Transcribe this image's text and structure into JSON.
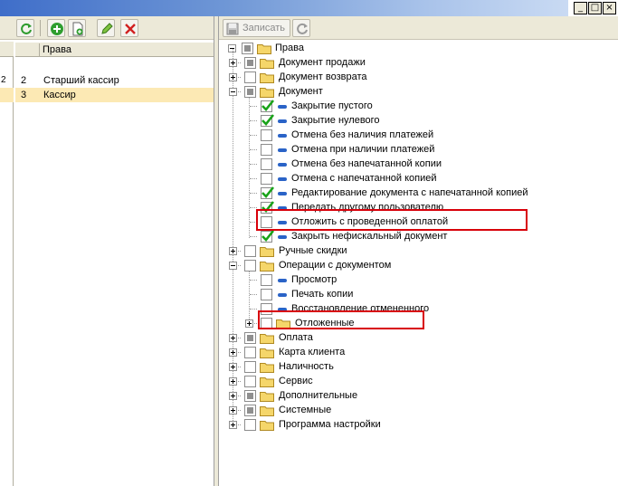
{
  "window": {
    "minimize_glyph": "_",
    "maximize_glyph": "□",
    "close_glyph": "×"
  },
  "left_toolbar": {
    "buttons": [
      "refresh-icon",
      "add-icon",
      "copy-icon",
      "edit-icon",
      "delete-icon"
    ]
  },
  "roles_list": {
    "column_header": "Права",
    "gutter_numbers": [
      "2"
    ],
    "rows": [
      {
        "num": "2",
        "name": "Старший кассир",
        "selected": false
      },
      {
        "num": "3",
        "name": "Кассир",
        "selected": true
      }
    ]
  },
  "right_toolbar": {
    "save_label": "Записать"
  },
  "rights_tree": {
    "root": "Права",
    "items": [
      {
        "label": "Документ продажи",
        "type": "folder",
        "check": "partial",
        "expander": "plus"
      },
      {
        "label": "Документ возврата",
        "type": "folder",
        "check": "none",
        "expander": "plus"
      },
      {
        "label": "Документ",
        "type": "folder",
        "check": "partial",
        "expander": "minus"
      },
      {
        "label": "Закрытие пустого",
        "type": "item",
        "check": "checked"
      },
      {
        "label": "Закрытие нулевого",
        "type": "item",
        "check": "checked"
      },
      {
        "label": "Отмена без наличия платежей",
        "type": "item",
        "check": "none"
      },
      {
        "label": "Отмена при наличии платежей",
        "type": "item",
        "check": "none"
      },
      {
        "label": "Отмена без напечатанной копии",
        "type": "item",
        "check": "none"
      },
      {
        "label": "Отмена с напечатанной копией",
        "type": "item",
        "check": "none"
      },
      {
        "label": "Редактирование документа с напечатанной копией",
        "type": "item",
        "check": "checked"
      },
      {
        "label": "Передать другому пользователю",
        "type": "item",
        "check": "checked"
      },
      {
        "label": "Отложить с проведенной оплатой",
        "type": "item",
        "check": "none"
      },
      {
        "label": "Закрыть нефискальный документ",
        "type": "item",
        "check": "checked"
      },
      {
        "label": "Ручные скидки",
        "type": "folder",
        "check": "none",
        "expander": "plus"
      },
      {
        "label": "Операции с документом",
        "type": "folder",
        "check": "none",
        "expander": "minus"
      },
      {
        "label": "Просмотр",
        "type": "item",
        "check": "none"
      },
      {
        "label": "Печать копии",
        "type": "item",
        "check": "none"
      },
      {
        "label": "Восстановление отмененного",
        "type": "item",
        "check": "none"
      },
      {
        "label": "Отложенные",
        "type": "folder",
        "check": "none",
        "expander": "plus"
      },
      {
        "label": "Оплата",
        "type": "folder",
        "check": "partial",
        "expander": "plus"
      },
      {
        "label": "Карта клиента",
        "type": "folder",
        "check": "none",
        "expander": "plus"
      },
      {
        "label": "Наличность",
        "type": "folder",
        "check": "none",
        "expander": "plus"
      },
      {
        "label": "Сервис",
        "type": "folder",
        "check": "none",
        "expander": "plus"
      },
      {
        "label": "Дополнительные",
        "type": "folder",
        "check": "partial",
        "expander": "plus"
      },
      {
        "label": "Системные",
        "type": "folder",
        "check": "partial",
        "expander": "plus"
      },
      {
        "label": "Программа настройки",
        "type": "folder",
        "check": "none",
        "expander": "plus"
      }
    ]
  },
  "colors": {
    "highlight_box": "#d8000a",
    "selected_row": "#fce9b4",
    "check_green": "#1aa31a",
    "folder_yellow": "#f5d66a"
  }
}
